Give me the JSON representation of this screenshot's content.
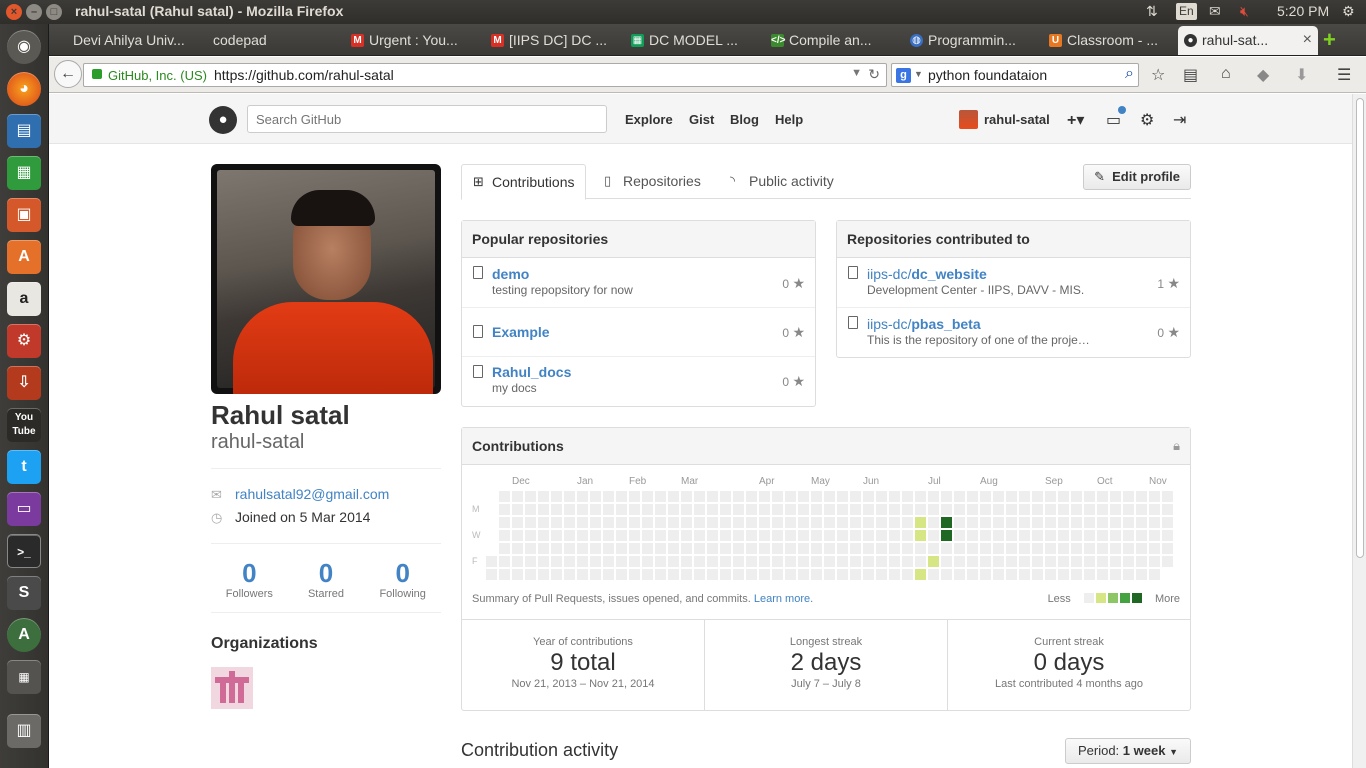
{
  "window": {
    "title": "rahul-satal (Rahul satal) - Mozilla Firefox",
    "time": "5:20 PM",
    "keyboard": "En"
  },
  "tabs": [
    {
      "label": "Devi Ahilya Univ...",
      "icon": "blank",
      "color": "#999999"
    },
    {
      "label": "codepad",
      "icon": "blank",
      "color": "#999999"
    },
    {
      "label": "Urgent : You...",
      "icon": "gmail-icon",
      "color": "#d93025"
    },
    {
      "label": "[IIPS DC] DC ...",
      "icon": "gmail-icon",
      "color": "#d93025"
    },
    {
      "label": "DC MODEL ...",
      "icon": "sheets-icon",
      "color": "#0f9d58"
    },
    {
      "label": "Compile an...",
      "icon": "code-icon",
      "color": "#3c8a2e"
    },
    {
      "label": "Programmin...",
      "icon": "globe-icon",
      "color": "#3a6fc6"
    },
    {
      "label": "Classroom - ...",
      "icon": "udacity-icon",
      "color": "#e87722"
    },
    {
      "label": "rahul-sat...",
      "icon": "github-icon",
      "color": "#333333"
    }
  ],
  "navbar": {
    "site_identity": "GitHub, Inc. (US)",
    "url": "https://github.com/rahul-satal",
    "search_value": "python foundataion"
  },
  "gh_header": {
    "search_placeholder": "Search GitHub",
    "nav": [
      "Explore",
      "Gist",
      "Blog",
      "Help"
    ],
    "username": "rahul-satal",
    "plus": "+▾"
  },
  "profile": {
    "fullname": "Rahul satal",
    "username": "rahul-satal",
    "email": "rahulsatal92@gmail.com",
    "joined": "Joined on 5 Mar 2014",
    "stats": [
      {
        "value": "0",
        "label": "Followers"
      },
      {
        "value": "0",
        "label": "Starred"
      },
      {
        "value": "0",
        "label": "Following"
      }
    ],
    "organizations_title": "Organizations"
  },
  "profile_tabs": [
    "Contributions",
    "Repositories",
    "Public activity"
  ],
  "edit_profile": "Edit profile",
  "popular_repos": {
    "title": "Popular repositories",
    "items": [
      {
        "name": "demo",
        "desc": "testing repopsitory for now",
        "stars": "0"
      },
      {
        "name": "Example",
        "desc": "",
        "stars": "0"
      },
      {
        "name": "Rahul_docs",
        "desc": "my docs",
        "stars": "0"
      }
    ]
  },
  "contributed_repos": {
    "title": "Repositories contributed to",
    "items": [
      {
        "owner": "iips-dc/",
        "name": "dc_website",
        "desc": "Development Center - IIPS, DAVV - MIS.",
        "stars": "1"
      },
      {
        "owner": "iips-dc/",
        "name": "pbas_beta",
        "desc": "This is the repository of one of the proje…",
        "stars": "0"
      }
    ]
  },
  "contributions": {
    "title": "Contributions",
    "months": [
      "Dec",
      "Jan",
      "Feb",
      "Mar",
      "Apr",
      "May",
      "Jun",
      "Jul",
      "Aug",
      "Sep",
      "Oct",
      "Nov"
    ],
    "day_labels": [
      "M",
      "W",
      "F"
    ],
    "summary": "Summary of Pull Requests, issues opened, and commits.",
    "learn_more": "Learn more.",
    "legend_less": "Less",
    "legend_more": "More",
    "colors": [
      "#eeeeee",
      "#d6e685",
      "#8cc665",
      "#44a340",
      "#1e6823"
    ],
    "active_days": [
      {
        "week": 33,
        "day": 2,
        "level": 1
      },
      {
        "week": 33,
        "day": 3,
        "level": 1
      },
      {
        "week": 33,
        "day": 6,
        "level": 1
      },
      {
        "week": 34,
        "day": 5,
        "level": 1
      },
      {
        "week": 35,
        "day": 2,
        "level": 4
      },
      {
        "week": 35,
        "day": 3,
        "level": 4
      }
    ],
    "stats": [
      {
        "title": "Year of contributions",
        "value": "9 total",
        "sub": "Nov 21, 2013 – Nov 21, 2014"
      },
      {
        "title": "Longest streak",
        "value": "2 days",
        "sub": "July 7 – July 8"
      },
      {
        "title": "Current streak",
        "value": "0 days",
        "sub": "Last contributed 4 months ago"
      }
    ]
  },
  "activity": {
    "title": "Contribution activity",
    "period_label": "Period:",
    "period_value": "1 week"
  }
}
